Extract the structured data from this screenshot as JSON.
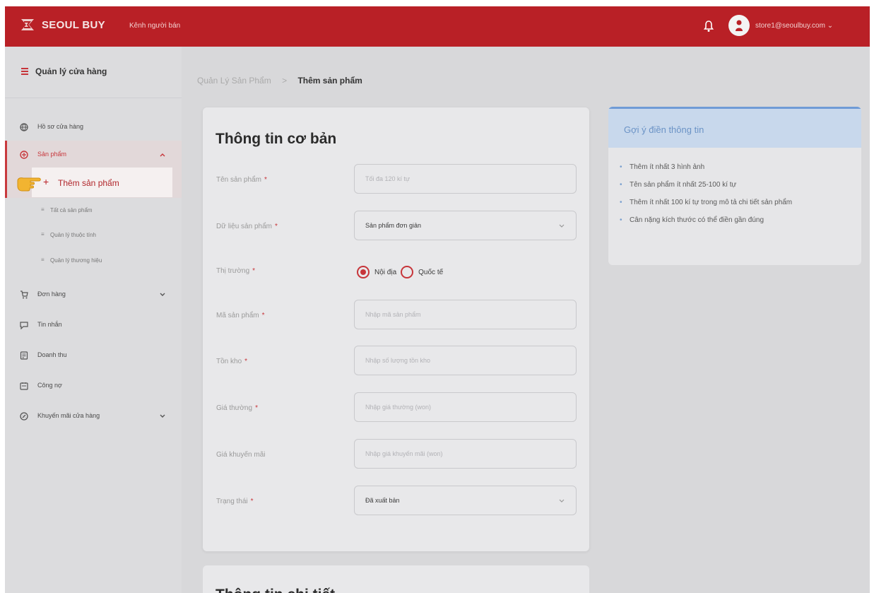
{
  "header": {
    "logo_text": "SEOUL BUY",
    "channel_label": "Kênh người bán",
    "user_email": "store1@seoulbuy.com",
    "brand_color": "#b92026"
  },
  "sidebar": {
    "title": "Quản lý cửa hàng",
    "items": [
      {
        "label": "Hồ sơ cửa hàng",
        "icon": "globe-icon"
      },
      {
        "label": "Sản phẩm",
        "icon": "box-icon"
      },
      {
        "label": "Đơn hàng",
        "icon": "cart-icon"
      },
      {
        "label": "Tin nhắn",
        "icon": "chat-icon"
      },
      {
        "label": "Doanh thu",
        "icon": "revenue-icon"
      },
      {
        "label": "Công nợ",
        "icon": "debt-icon"
      },
      {
        "label": "Khuyến mãi cửa hàng",
        "icon": "promotion-icon"
      }
    ],
    "sub_items": [
      {
        "label": "Thêm sản phẩm",
        "active": true
      },
      {
        "label": "Tất cả sản phẩm"
      },
      {
        "label": "Quản lý thuộc tính"
      },
      {
        "label": "Quản lý thương hiệu"
      }
    ]
  },
  "breadcrumb": {
    "parent": "Quản Lý Sản Phẩm",
    "separator": ">",
    "current": "Thêm sản phẩm"
  },
  "form": {
    "title": "Thông tin cơ bản",
    "fields": {
      "name": {
        "label": "Tên sản phẩm",
        "placeholder": "Tối đa 120 kí tự",
        "required": "*"
      },
      "data": {
        "label": "Dữ liệu sản phẩm",
        "value": "Sản phẩm đơn giản",
        "required": "*"
      },
      "market": {
        "label": "Thị trường",
        "required": "*",
        "options": [
          "Nội địa",
          "Quốc tế"
        ],
        "selected": "Nội địa"
      },
      "code": {
        "label": "Mã sản phẩm",
        "placeholder": "Nhập mã sản phẩm",
        "required": "*"
      },
      "stock": {
        "label": "Tồn kho",
        "placeholder": "Nhập số lượng tồn kho",
        "required": "*"
      },
      "price": {
        "label": "Giá thường",
        "placeholder": "Nhập giá thường (won)",
        "required": "*"
      },
      "sale_price": {
        "label": "Giá khuyến mãi",
        "placeholder": "Nhập giá khuyến mãi (won)"
      },
      "status": {
        "label": "Trạng thái",
        "value": "Đã xuất bản",
        "required": "*"
      }
    }
  },
  "detail_section": {
    "title": "Thông tin chi tiết"
  },
  "hint": {
    "title": "Gợi ý điền thông tin",
    "items": [
      "Thêm ít nhất 3 hình ảnh",
      "Tên sản phẩm ít nhất 25-100 kí tự",
      "Thêm ít nhất 100 kí tự trong mô tả chi tiết sản phẩm",
      "Cân nặng kích thước có thể điền gần đúng"
    ]
  }
}
